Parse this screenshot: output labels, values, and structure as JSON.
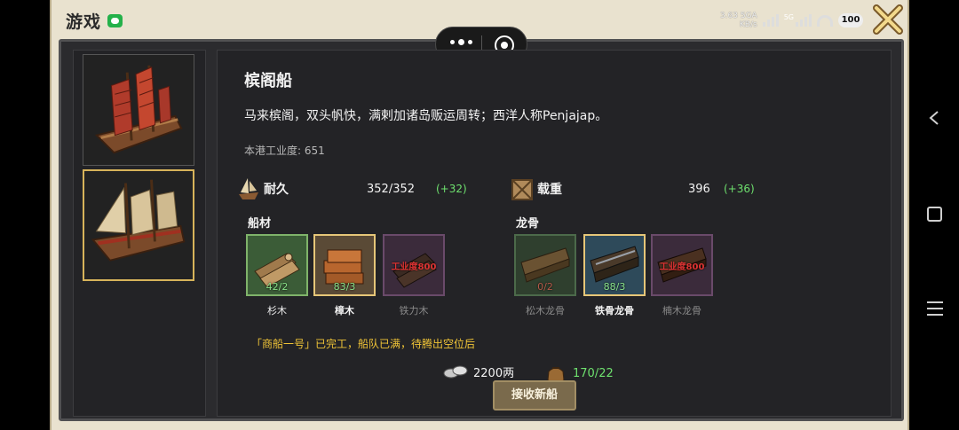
{
  "topbar": {
    "app_logo": "游戏",
    "net_speed": "3.63",
    "net_unit": "KB/s",
    "net_type": "5GA",
    "net_type2": "5G",
    "battery": "100"
  },
  "ship_list": {
    "items": [
      {
        "name": "junk-ship",
        "selected": false
      },
      {
        "name": "penjajap-ship",
        "selected": true
      }
    ]
  },
  "ship": {
    "title": "槟阁船",
    "description": "马来槟阁，双头帆快，满剌加诸岛贩运周转；西洋人称Penjajap。",
    "industry_label": "本港工业度:",
    "industry_value": "651",
    "durability": {
      "label": "耐久",
      "value": "352/352",
      "bonus": "(+32)"
    },
    "cargo": {
      "label": "载重",
      "value": "396",
      "bonus": "(+36)"
    }
  },
  "materials": {
    "hull_label": "船材",
    "hull": [
      {
        "name": "杉木",
        "count": "42/2",
        "locked": false,
        "selected": false
      },
      {
        "name": "樟木",
        "count": "83/3",
        "locked": false,
        "selected": true
      },
      {
        "name": "铁力木",
        "count": "",
        "locked": true,
        "lock_text": "工业度800",
        "selected": false
      }
    ],
    "keel_label": "龙骨",
    "keel": [
      {
        "name": "松木龙骨",
        "count": "0/2",
        "locked": false,
        "selected": false
      },
      {
        "name": "铁骨龙骨",
        "count": "88/3",
        "locked": false,
        "selected": true
      },
      {
        "name": "楠木龙骨",
        "count": "",
        "locked": true,
        "lock_text": "工业度800",
        "selected": false
      }
    ]
  },
  "message": "「商船一号」已完工，船队已满，待腾出空位后",
  "costs": {
    "silver": "2200两",
    "food": "170/22"
  },
  "confirm_button": "接收新船",
  "colors": {
    "accent_gold": "#d7b35a",
    "bonus_green": "#6ee06e",
    "warning_yellow": "#f0c437",
    "panel_bg": "#232326"
  }
}
